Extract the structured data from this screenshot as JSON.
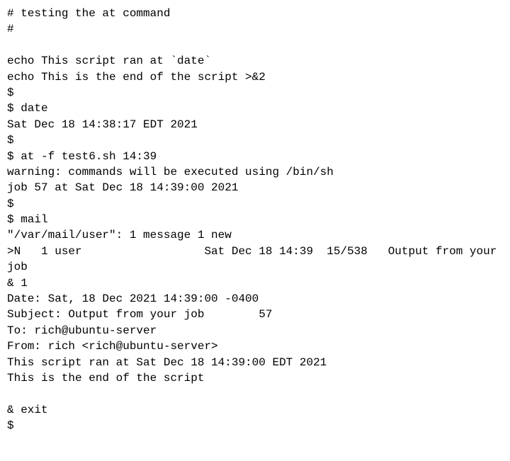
{
  "terminal": {
    "lines": [
      "# testing the at command",
      "#",
      "",
      "echo This script ran at `date`",
      "echo This is the end of the script >&2",
      "$",
      "$ date",
      "Sat Dec 18 14:38:17 EDT 2021",
      "$",
      "$ at -f test6.sh 14:39",
      "warning: commands will be executed using /bin/sh",
      "job 57 at Sat Dec 18 14:39:00 2021",
      "$",
      "$ mail",
      "\"/var/mail/user\": 1 message 1 new",
      ">N   1 user                  Sat Dec 18 14:39  15/538   Output from your",
      "job",
      "& 1",
      "Date: Sat, 18 Dec 2021 14:39:00 -0400",
      "Subject: Output from your job        57",
      "To: rich@ubuntu-server",
      "From: rich <rich@ubuntu-server>",
      "This script ran at Sat Dec 18 14:39:00 EDT 2021",
      "This is the end of the script",
      "",
      "& exit",
      "$"
    ]
  }
}
